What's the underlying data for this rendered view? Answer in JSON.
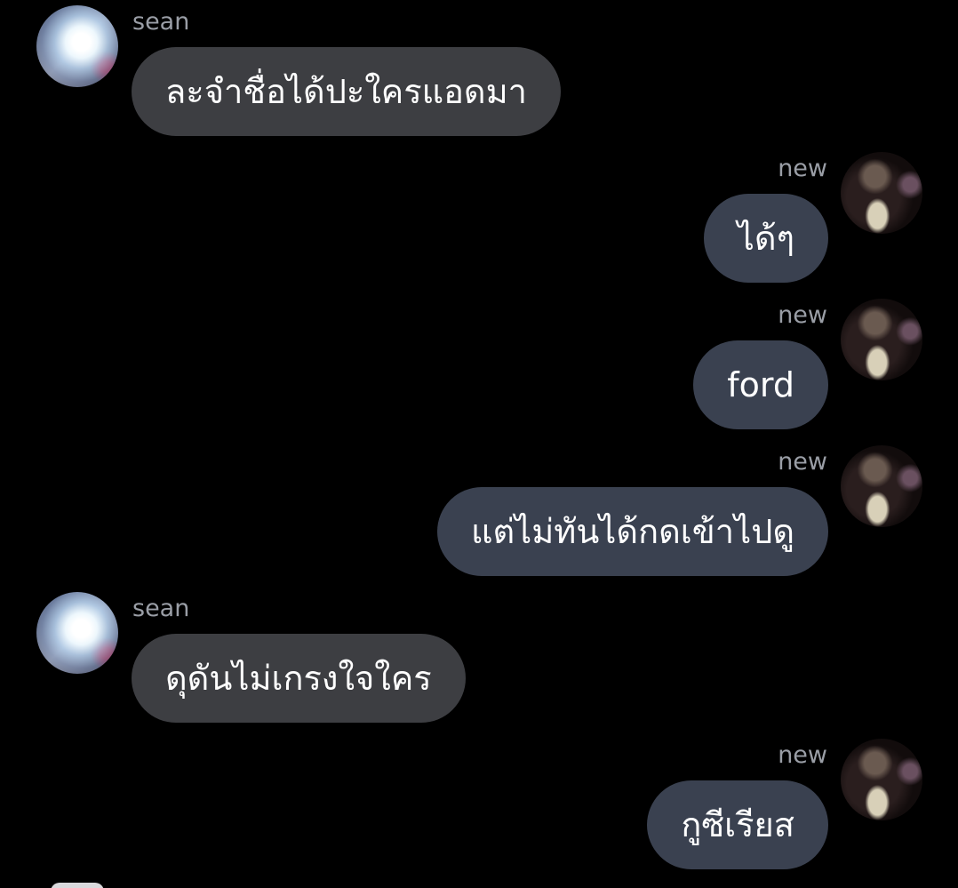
{
  "messages": [
    {
      "sender": "sean",
      "text": "ละจำชื่อได้ปะใครแอดมา",
      "side": "left"
    },
    {
      "sender": "new",
      "text": "ได้ๆ",
      "side": "right"
    },
    {
      "sender": "new",
      "text": "ford",
      "side": "right"
    },
    {
      "sender": "new",
      "text": "แต่ไม่ทันได้กดเข้าไปดู",
      "side": "right"
    },
    {
      "sender": "sean",
      "text": "ดุดันไม่เกรงใจใคร",
      "side": "left"
    },
    {
      "sender": "new",
      "text": "กูซีเรียส",
      "side": "right"
    }
  ],
  "colors": {
    "background": "#000000",
    "incoming_bubble": "#3d3e42",
    "outgoing_bubble": "#3a4150",
    "sender_name": "#9a9ea6",
    "message_text": "#ffffff"
  }
}
